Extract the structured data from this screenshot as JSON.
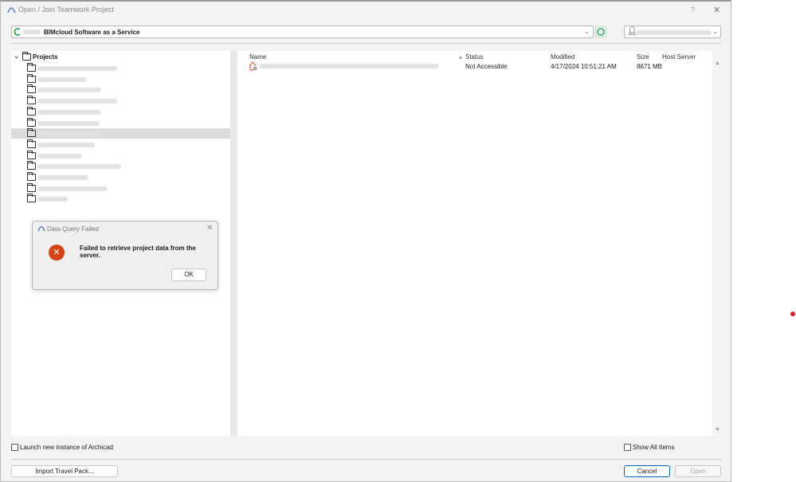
{
  "window": {
    "title": "Open / Join Teamwork Project",
    "help": "?",
    "close": "✕"
  },
  "server": {
    "name": "BIMcloud Software as a Service"
  },
  "tree": {
    "root": "Projects",
    "selected_index": 6,
    "folder_count": 13
  },
  "columns": {
    "name": "Name",
    "status": "Status",
    "modified": "Modified",
    "size": "Size",
    "host": "Host Server"
  },
  "files": [
    {
      "status": "Not Accessible",
      "modified": "4/17/2024 10:51:21 AM",
      "size": "8671 MB"
    }
  ],
  "launch_new_instance": {
    "label": "Launch new instance of Archicad",
    "checked": false
  },
  "show_all_items": {
    "label": "Show All Items",
    "checked": false
  },
  "buttons": {
    "import": "Import Travel Pack...",
    "cancel": "Cancel",
    "open": "Open"
  },
  "dialog": {
    "title": "Data Query Failed",
    "message": "Failed to retrieve project data from the server.",
    "ok": "OK",
    "close": "✕"
  },
  "colors": {
    "accent": "#0067c0",
    "error": "#d84315",
    "marker": "#e81c1c"
  }
}
